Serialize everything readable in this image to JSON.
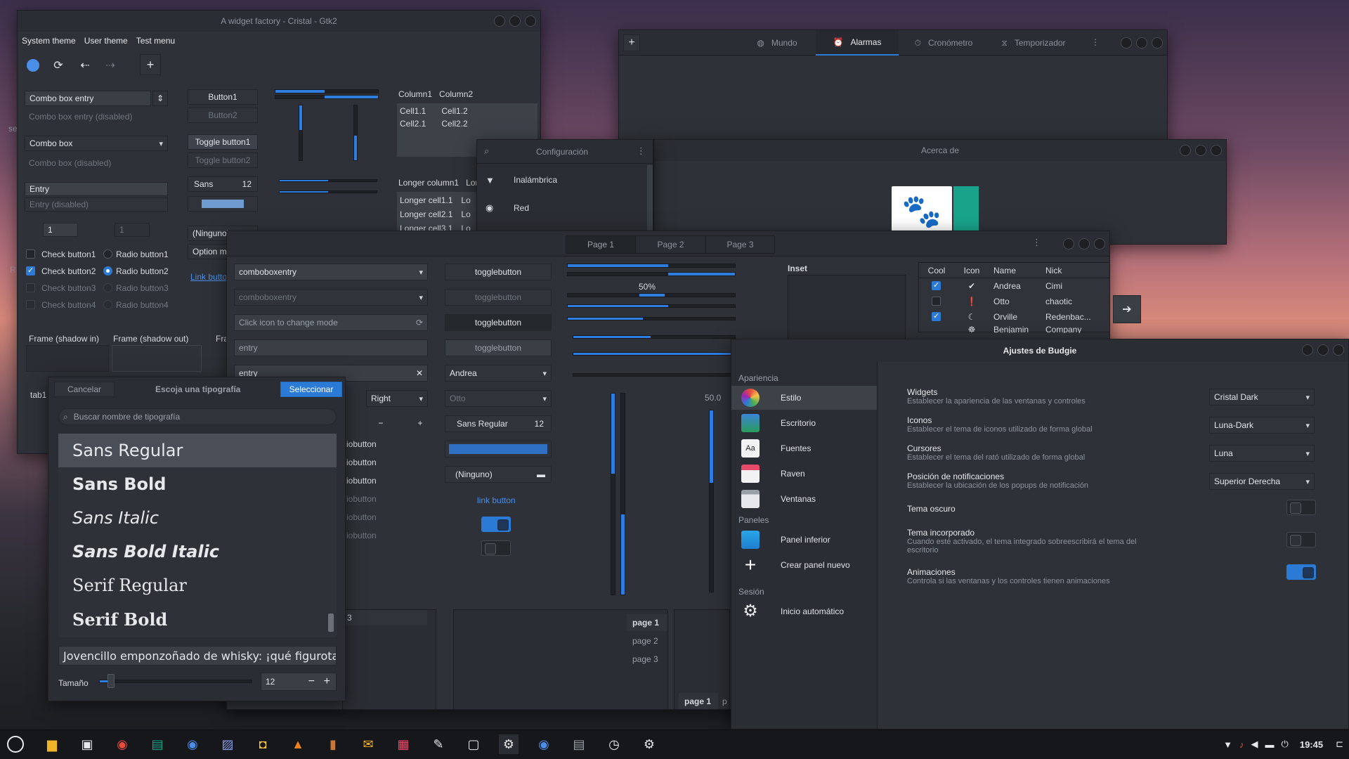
{
  "colors": {
    "accent": "#2b7bd6",
    "panel_bg": "#2e3238",
    "titlebar": "#2a2d33",
    "taskbar": "#16171a",
    "text": "#d6d9de"
  },
  "widget_factory": {
    "title": "A widget factory - Cristal - Gtk2",
    "menu": [
      "System theme",
      "User theme",
      "Test menu"
    ],
    "combo_entry": "Combo box entry",
    "combo_entry_disabled": "Combo box entry (disabled)",
    "combo": "Combo box",
    "combo_disabled": "Combo box (disabled)",
    "entry": "Entry",
    "entry_disabled": "Entry (disabled)",
    "spin1": "1",
    "spin2": "1",
    "buttons": [
      "Button1",
      "Button2",
      "Toggle button1",
      "Toggle button2"
    ],
    "font_btn": {
      "name": "Sans",
      "size": "12"
    },
    "file_btn": "(Ninguno)",
    "option_menu": "Option m",
    "link": "Link butto",
    "checks": [
      "Check button1",
      "Check button2",
      "Check button3",
      "Check button4"
    ],
    "radios": [
      "Radio button1",
      "Radio button2",
      "Radio button3",
      "Radio button4"
    ],
    "frames": [
      "Frame (shadow in)",
      "Frame (shadow out)",
      "Fra"
    ],
    "tab": "tab1",
    "tree1": {
      "headers": [
        "Column1",
        "Column2"
      ],
      "rows": [
        [
          "Cell1.1",
          "Cell1.2"
        ],
        [
          "Cell2.1",
          "Cell2.2"
        ]
      ]
    },
    "tree2": {
      "headers": [
        "Longer column1",
        "Lor"
      ],
      "rows": [
        [
          "Longer cell1.1",
          "Lo"
        ],
        [
          "Longer cell2.1",
          "Lo"
        ],
        [
          "Longer cell3.1",
          "Lo"
        ]
      ]
    }
  },
  "clocks": {
    "tabs": [
      "Mundo",
      "Alarmas",
      "Cronómetro",
      "Temporizador"
    ],
    "active": "Alarmas"
  },
  "config": {
    "title": "Configuración",
    "items": [
      "Inalámbrica",
      "Red"
    ]
  },
  "about": {
    "title": "Acerca de"
  },
  "gtk3": {
    "tabs": [
      "Page 1",
      "Page 2",
      "Page 3"
    ],
    "comboboxentry": "comboboxentry",
    "comboboxentry_dis": "comboboxentry",
    "mode_entry": "Click icon to change mode",
    "entry1": "entry",
    "entry2": "entry",
    "right_combo": "Right",
    "togglebuttons": [
      "togglebutton",
      "togglebutton",
      "togglebutton",
      "togglebutton"
    ],
    "combo_andrea": "Andrea",
    "combo_otto": "Otto",
    "font": {
      "name": "Sans Regular",
      "size": "12"
    },
    "file": "(Ninguno)",
    "link": "link button",
    "progress_label": "50%",
    "scale_value": "50.0",
    "radiobuttons": [
      "iobutton",
      "iobutton",
      "iobutton",
      "iobutton",
      "iobutton",
      "iobutton"
    ],
    "inset": "Inset",
    "tree": {
      "headers": [
        "Cool",
        "Icon",
        "Name",
        "Nick"
      ],
      "rows": [
        {
          "cool": true,
          "name": "Andrea",
          "nick": "Cimi"
        },
        {
          "cool": false,
          "name": "Otto",
          "nick": "chaotic"
        },
        {
          "cool": true,
          "name": "Orville",
          "nick": "Redenbac..."
        },
        {
          "cool": false,
          "name": "Benjamin",
          "nick": "Company"
        }
      ]
    },
    "page_tabs": [
      "page 1",
      "page 2",
      "page 3"
    ],
    "bottom_tabs": [
      "page 1",
      "p"
    ],
    "partial_tab": "3",
    "progress": {
      "top1": 0.48,
      "top2": 0.52,
      "mid": 0.5
    }
  },
  "font_chooser": {
    "cancel": "Cancelar",
    "title": "Escoja una tipografía",
    "select": "Seleccionar",
    "search_placeholder": "Buscar nombre de tipografía",
    "fonts": [
      "Sans Regular",
      "Sans Bold",
      "Sans Italic",
      "Sans Bold Italic",
      "Serif Regular",
      "Serif Bold"
    ],
    "preview": "Jovencillo emponzoñado de whisky: ¡qué figurota",
    "size_label": "Tamaño",
    "size": "12"
  },
  "budgie": {
    "title": "Ajustes de Budgie",
    "sections": [
      {
        "header": "Apariencia",
        "items": [
          "Estilo",
          "Escritorio",
          "Fuentes",
          "Raven",
          "Ventanas"
        ]
      },
      {
        "header": "Paneles",
        "items": [
          "Panel inferior",
          "Crear panel nuevo"
        ]
      },
      {
        "header": "Sesión",
        "items": [
          "Inicio automático"
        ]
      }
    ],
    "settings": [
      {
        "title": "Widgets",
        "desc": "Establecer la apariencia de las ventanas y controles",
        "value": "Cristal Dark"
      },
      {
        "title": "Iconos",
        "desc": "Establecer el tema de iconos utilizado de forma global",
        "value": "Luna-Dark"
      },
      {
        "title": "Cursores",
        "desc": "Establecer el tema del rató utilizado de forma global",
        "value": "Luna"
      },
      {
        "title": "Posición de notificaciones",
        "desc": "Establecer la ubicación de los popups de notificación",
        "value": "Superior Derecha"
      }
    ],
    "toggles": [
      {
        "title": "Tema oscuro",
        "desc": "",
        "on": false
      },
      {
        "title": "Tema incorporado",
        "desc": "Cuando esté activado, el tema integrado sobreescribirá el tema del escritorio",
        "on": false
      },
      {
        "title": "Animaciones",
        "desc": "Controla si las ventanas y los controles tienen animaciones",
        "on": true
      }
    ]
  },
  "desktop_fragments": [
    "se",
    "R"
  ],
  "taskbar": {
    "clock": "19:45"
  }
}
